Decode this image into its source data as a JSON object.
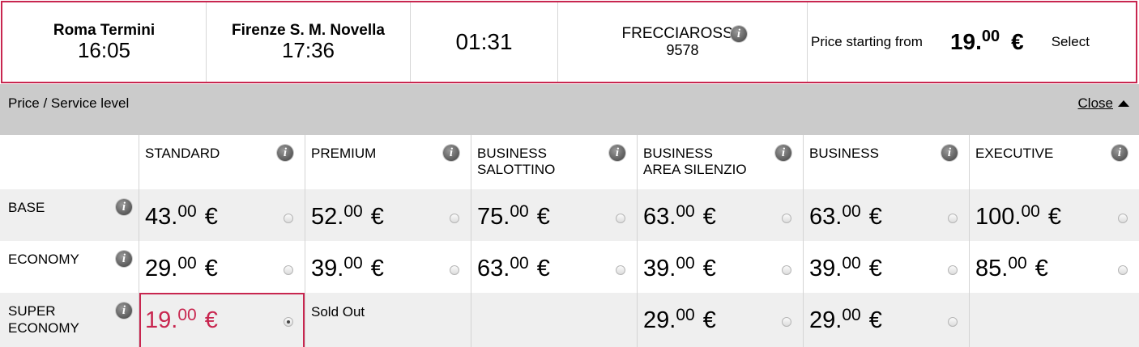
{
  "summary": {
    "departure": {
      "station": "Roma Termini",
      "time": "16:05"
    },
    "arrival": {
      "station": "Firenze S. M. Novella",
      "time": "17:36"
    },
    "duration": "01:31",
    "train": {
      "name": "FRECCIAROSSA",
      "number": "9578"
    },
    "price_label": "Price starting from",
    "price_int": "19.",
    "price_dec": "00",
    "currency": "€",
    "select_label": "Select"
  },
  "panel": {
    "title": "Price / Service level",
    "close_label": "Close"
  },
  "service_levels": [
    {
      "name_line1": "STANDARD",
      "name_line2": ""
    },
    {
      "name_line1": "PREMIUM",
      "name_line2": ""
    },
    {
      "name_line1": "BUSINESS",
      "name_line2": "SALOTTINO"
    },
    {
      "name_line1": "BUSINESS",
      "name_line2": "AREA SILENZIO"
    },
    {
      "name_line1": "BUSINESS",
      "name_line2": ""
    },
    {
      "name_line1": "EXECUTIVE",
      "name_line2": ""
    }
  ],
  "fare_types": [
    {
      "name_line1": "BASE",
      "name_line2": "",
      "prices": [
        {
          "int": "43.",
          "dec": "00"
        },
        {
          "int": "52.",
          "dec": "00"
        },
        {
          "int": "75.",
          "dec": "00"
        },
        {
          "int": "63.",
          "dec": "00"
        },
        {
          "int": "63.",
          "dec": "00"
        },
        {
          "int": "100.",
          "dec": "00"
        }
      ]
    },
    {
      "name_line1": "ECONOMY",
      "name_line2": "",
      "prices": [
        {
          "int": "29.",
          "dec": "00"
        },
        {
          "int": "39.",
          "dec": "00"
        },
        {
          "int": "63.",
          "dec": "00"
        },
        {
          "int": "39.",
          "dec": "00"
        },
        {
          "int": "39.",
          "dec": "00"
        },
        {
          "int": "85.",
          "dec": "00"
        }
      ]
    },
    {
      "name_line1": "SUPER",
      "name_line2": "ECONOMY",
      "prices": [
        {
          "int": "19.",
          "dec": "00",
          "selected": true
        },
        {
          "status": "Sold Out"
        },
        {
          "status": ""
        },
        {
          "int": "29.",
          "dec": "00"
        },
        {
          "int": "29.",
          "dec": "00"
        },
        {
          "status": ""
        }
      ]
    }
  ],
  "colors": {
    "accent": "#c8264f",
    "header_bar": "#cbcbcb",
    "row_alt": "#efefef"
  },
  "icons": {
    "info": "info-icon",
    "collapse": "triangle-up-icon",
    "radio": "radio-button"
  }
}
